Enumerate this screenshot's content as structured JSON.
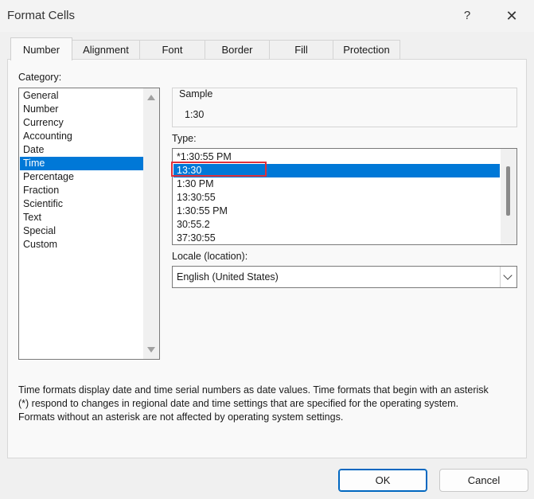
{
  "window": {
    "title": "Format Cells",
    "help": "?",
    "close": "✕"
  },
  "tabs": [
    "Number",
    "Alignment",
    "Font",
    "Border",
    "Fill",
    "Protection"
  ],
  "category": {
    "label": "Category:",
    "items": [
      "General",
      "Number",
      "Currency",
      "Accounting",
      "Date",
      "Time",
      "Percentage",
      "Fraction",
      "Scientific",
      "Text",
      "Special",
      "Custom"
    ],
    "selected": "Time"
  },
  "sample": {
    "label": "Sample",
    "value": "1:30"
  },
  "type": {
    "label": "Type:",
    "items": [
      "*1:30:55 PM",
      "13:30",
      "1:30 PM",
      "13:30:55",
      "1:30:55 PM",
      "30:55.2",
      "37:30:55"
    ],
    "selected": "13:30"
  },
  "locale": {
    "label": "Locale (location):",
    "value": "English (United States)"
  },
  "description": {
    "line1": "Time formats display date and time serial numbers as date values.  Time formats that begin with an asterisk",
    "line2": "(*) respond to changes in regional date and time settings that are specified for the operating system.",
    "line3": "Formats without an asterisk are not affected by operating system settings."
  },
  "buttons": {
    "ok": "OK",
    "cancel": "Cancel"
  },
  "colors": {
    "selection": "#0078d7",
    "highlight_box": "#e0303a",
    "default_button_border": "#0067c0"
  }
}
